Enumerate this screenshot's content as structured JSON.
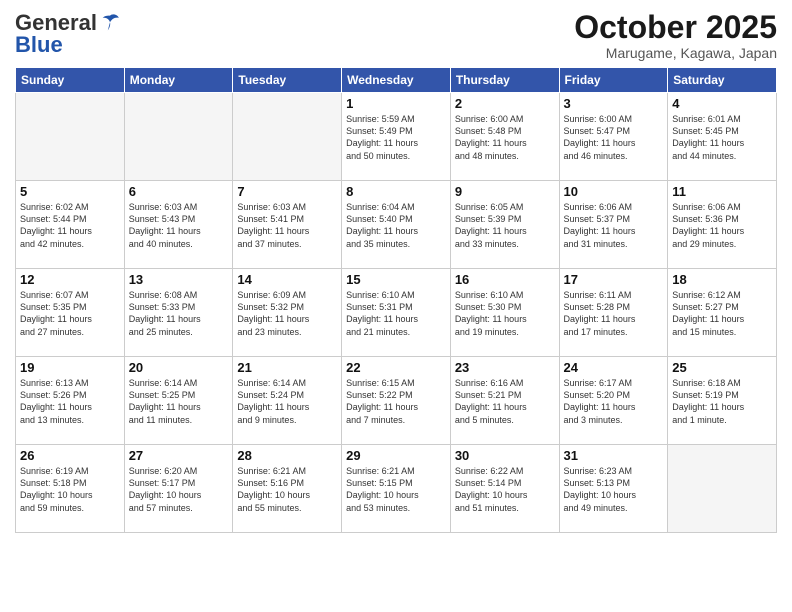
{
  "header": {
    "logo_general": "General",
    "logo_blue": "Blue",
    "month": "October 2025",
    "location": "Marugame, Kagawa, Japan"
  },
  "weekdays": [
    "Sunday",
    "Monday",
    "Tuesday",
    "Wednesday",
    "Thursday",
    "Friday",
    "Saturday"
  ],
  "weeks": [
    [
      {
        "day": "",
        "info": ""
      },
      {
        "day": "",
        "info": ""
      },
      {
        "day": "",
        "info": ""
      },
      {
        "day": "1",
        "info": "Sunrise: 5:59 AM\nSunset: 5:49 PM\nDaylight: 11 hours\nand 50 minutes."
      },
      {
        "day": "2",
        "info": "Sunrise: 6:00 AM\nSunset: 5:48 PM\nDaylight: 11 hours\nand 48 minutes."
      },
      {
        "day": "3",
        "info": "Sunrise: 6:00 AM\nSunset: 5:47 PM\nDaylight: 11 hours\nand 46 minutes."
      },
      {
        "day": "4",
        "info": "Sunrise: 6:01 AM\nSunset: 5:45 PM\nDaylight: 11 hours\nand 44 minutes."
      }
    ],
    [
      {
        "day": "5",
        "info": "Sunrise: 6:02 AM\nSunset: 5:44 PM\nDaylight: 11 hours\nand 42 minutes."
      },
      {
        "day": "6",
        "info": "Sunrise: 6:03 AM\nSunset: 5:43 PM\nDaylight: 11 hours\nand 40 minutes."
      },
      {
        "day": "7",
        "info": "Sunrise: 6:03 AM\nSunset: 5:41 PM\nDaylight: 11 hours\nand 37 minutes."
      },
      {
        "day": "8",
        "info": "Sunrise: 6:04 AM\nSunset: 5:40 PM\nDaylight: 11 hours\nand 35 minutes."
      },
      {
        "day": "9",
        "info": "Sunrise: 6:05 AM\nSunset: 5:39 PM\nDaylight: 11 hours\nand 33 minutes."
      },
      {
        "day": "10",
        "info": "Sunrise: 6:06 AM\nSunset: 5:37 PM\nDaylight: 11 hours\nand 31 minutes."
      },
      {
        "day": "11",
        "info": "Sunrise: 6:06 AM\nSunset: 5:36 PM\nDaylight: 11 hours\nand 29 minutes."
      }
    ],
    [
      {
        "day": "12",
        "info": "Sunrise: 6:07 AM\nSunset: 5:35 PM\nDaylight: 11 hours\nand 27 minutes."
      },
      {
        "day": "13",
        "info": "Sunrise: 6:08 AM\nSunset: 5:33 PM\nDaylight: 11 hours\nand 25 minutes."
      },
      {
        "day": "14",
        "info": "Sunrise: 6:09 AM\nSunset: 5:32 PM\nDaylight: 11 hours\nand 23 minutes."
      },
      {
        "day": "15",
        "info": "Sunrise: 6:10 AM\nSunset: 5:31 PM\nDaylight: 11 hours\nand 21 minutes."
      },
      {
        "day": "16",
        "info": "Sunrise: 6:10 AM\nSunset: 5:30 PM\nDaylight: 11 hours\nand 19 minutes."
      },
      {
        "day": "17",
        "info": "Sunrise: 6:11 AM\nSunset: 5:28 PM\nDaylight: 11 hours\nand 17 minutes."
      },
      {
        "day": "18",
        "info": "Sunrise: 6:12 AM\nSunset: 5:27 PM\nDaylight: 11 hours\nand 15 minutes."
      }
    ],
    [
      {
        "day": "19",
        "info": "Sunrise: 6:13 AM\nSunset: 5:26 PM\nDaylight: 11 hours\nand 13 minutes."
      },
      {
        "day": "20",
        "info": "Sunrise: 6:14 AM\nSunset: 5:25 PM\nDaylight: 11 hours\nand 11 minutes."
      },
      {
        "day": "21",
        "info": "Sunrise: 6:14 AM\nSunset: 5:24 PM\nDaylight: 11 hours\nand 9 minutes."
      },
      {
        "day": "22",
        "info": "Sunrise: 6:15 AM\nSunset: 5:22 PM\nDaylight: 11 hours\nand 7 minutes."
      },
      {
        "day": "23",
        "info": "Sunrise: 6:16 AM\nSunset: 5:21 PM\nDaylight: 11 hours\nand 5 minutes."
      },
      {
        "day": "24",
        "info": "Sunrise: 6:17 AM\nSunset: 5:20 PM\nDaylight: 11 hours\nand 3 minutes."
      },
      {
        "day": "25",
        "info": "Sunrise: 6:18 AM\nSunset: 5:19 PM\nDaylight: 11 hours\nand 1 minute."
      }
    ],
    [
      {
        "day": "26",
        "info": "Sunrise: 6:19 AM\nSunset: 5:18 PM\nDaylight: 10 hours\nand 59 minutes."
      },
      {
        "day": "27",
        "info": "Sunrise: 6:20 AM\nSunset: 5:17 PM\nDaylight: 10 hours\nand 57 minutes."
      },
      {
        "day": "28",
        "info": "Sunrise: 6:21 AM\nSunset: 5:16 PM\nDaylight: 10 hours\nand 55 minutes."
      },
      {
        "day": "29",
        "info": "Sunrise: 6:21 AM\nSunset: 5:15 PM\nDaylight: 10 hours\nand 53 minutes."
      },
      {
        "day": "30",
        "info": "Sunrise: 6:22 AM\nSunset: 5:14 PM\nDaylight: 10 hours\nand 51 minutes."
      },
      {
        "day": "31",
        "info": "Sunrise: 6:23 AM\nSunset: 5:13 PM\nDaylight: 10 hours\nand 49 minutes."
      },
      {
        "day": "",
        "info": ""
      }
    ]
  ]
}
